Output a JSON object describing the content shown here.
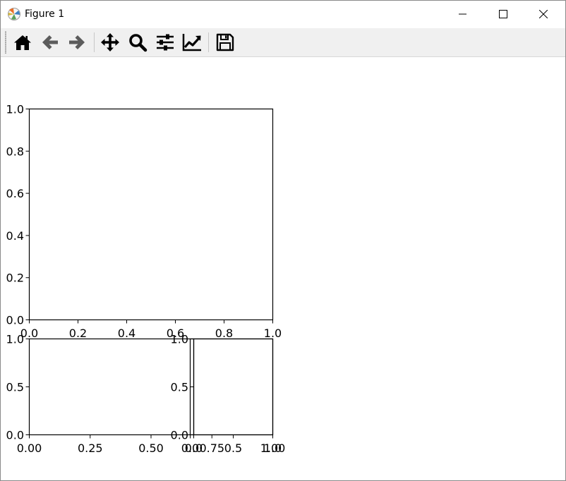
{
  "window": {
    "title": "Figure 1",
    "app_icon": "matplotlib-logo-icon",
    "controls": [
      "minimize-icon",
      "maximize-icon",
      "close-icon"
    ]
  },
  "toolbar": {
    "buttons": [
      {
        "name": "home-button",
        "icon": "home-icon"
      },
      {
        "name": "back-button",
        "icon": "arrow-left-icon"
      },
      {
        "name": "forward-button",
        "icon": "arrow-right-icon"
      },
      {
        "name": "pan-button",
        "icon": "move-arrows-icon"
      },
      {
        "name": "zoom-button",
        "icon": "magnifier-icon"
      },
      {
        "name": "configure-subplots-button",
        "icon": "sliders-icon"
      },
      {
        "name": "edit-axes-button",
        "icon": "line-chart-icon"
      },
      {
        "name": "save-button",
        "icon": "floppy-disk-icon"
      }
    ]
  },
  "chart_data": [
    {
      "type": "line",
      "title": "",
      "xlabel": "",
      "ylabel": "",
      "xlim": [
        0,
        1
      ],
      "ylim": [
        0,
        1
      ],
      "xticks": [
        "0.0",
        "0.2",
        "0.4",
        "0.6",
        "0.8",
        "1.0"
      ],
      "yticks": [
        "0.0",
        "0.2",
        "0.4",
        "0.6",
        "0.8",
        "1.0"
      ],
      "grid": false,
      "series": []
    },
    {
      "type": "line",
      "title": "",
      "xlabel": "",
      "ylabel": "",
      "xlim": [
        0,
        1
      ],
      "ylim": [
        0,
        1
      ],
      "xticks": [
        "0.00",
        "0.25",
        "0.50",
        "0.75",
        "1.00"
      ],
      "yticks": [
        "0.0",
        "0.5",
        "1.0"
      ],
      "grid": false,
      "series": []
    },
    {
      "type": "line",
      "title": "",
      "xlabel": "",
      "ylabel": "",
      "xlim": [
        0,
        1
      ],
      "ylim": [
        0,
        1
      ],
      "xticks": [
        "0.0"
      ],
      "yticks": [],
      "grid": false,
      "series": []
    },
    {
      "type": "line",
      "title": "",
      "xlabel": "",
      "ylabel": "",
      "xlim": [
        0,
        1
      ],
      "ylim": [
        0,
        1
      ],
      "xticks": [
        "0.0",
        "0.5",
        "1.0"
      ],
      "yticks": [
        "0.0",
        "0.5",
        "1.0"
      ],
      "grid": false,
      "series": []
    }
  ]
}
